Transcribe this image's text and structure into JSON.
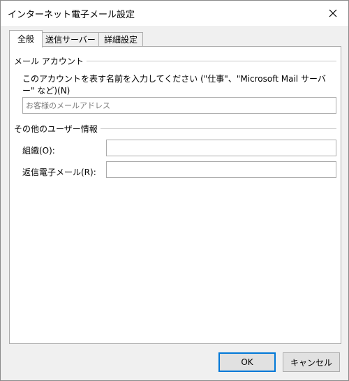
{
  "window": {
    "title": "インターネット電子メール設定"
  },
  "tabs": [
    {
      "label": "全般",
      "active": true
    },
    {
      "label": "送信サーバー",
      "active": false
    },
    {
      "label": "詳細設定",
      "active": false
    }
  ],
  "mail_account": {
    "group_label": "メール アカウント",
    "description": "このアカウントを表す名前を入力してください (\"仕事\"、\"Microsoft Mail サーバー\" など)(N)",
    "name_placeholder": "お客様のメールアドレス"
  },
  "user_info": {
    "group_label": "その他のユーザー情報",
    "org_label": "組織(O):",
    "reply_label": "返信電子メール(R):"
  },
  "buttons": {
    "ok": "OK",
    "cancel": "キャンセル"
  }
}
